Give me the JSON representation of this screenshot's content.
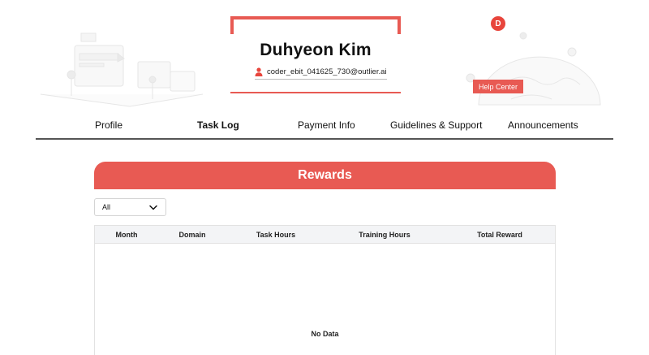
{
  "profile": {
    "name": "Duhyeon Kim",
    "email": "coder_ebit_041625_730@outlier.ai",
    "avatar_initial": "D"
  },
  "help_center": {
    "label": "Help Center"
  },
  "nav": {
    "items": [
      {
        "label": "Profile",
        "active": false
      },
      {
        "label": "Task Log",
        "active": true
      },
      {
        "label": "Payment Info",
        "active": false
      },
      {
        "label": "Guidelines & Support",
        "active": false
      },
      {
        "label": "Announcements",
        "active": false
      }
    ]
  },
  "rewards": {
    "title": "Rewards",
    "filter": {
      "selected": "All"
    },
    "table": {
      "columns": [
        "Month",
        "Domain",
        "Task Hours",
        "Training Hours",
        "Total Reward"
      ],
      "empty_text": "No Data"
    }
  },
  "colors": {
    "accent": "#e85a53",
    "avatar": "#e8453c",
    "table_header_bg": "#f3f4f6",
    "nav_divider": "#555555"
  },
  "icons": {
    "user": "user-icon",
    "dropdown": "chevron-down-icon"
  }
}
